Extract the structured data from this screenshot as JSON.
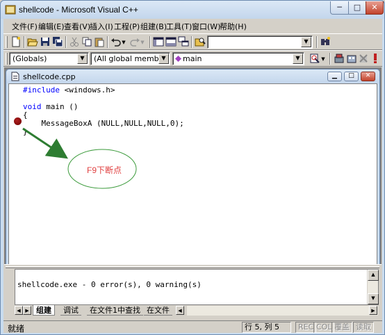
{
  "window": {
    "title": "shellcode - Microsoft Visual C++",
    "min_glyph": "─",
    "max_glyph": "□",
    "close_glyph": "✕"
  },
  "menu": [
    "文件(F)",
    "编辑(E)",
    "查看(V)",
    "插入(I)",
    "工程(P)",
    "组建(B)",
    "工具(T)",
    "窗口(W)",
    "帮助(H)"
  ],
  "toolbar": {
    "find_combo_value": "",
    "dropdown_glyph": "▼"
  },
  "wizardbar": {
    "class_combo": "(Globals)",
    "filter_combo": "(All global members",
    "member_combo": "main",
    "dropdown_glyph": "▼"
  },
  "document": {
    "title": "shellcode.cpp",
    "min_glyph": "▁",
    "max_glyph": "□",
    "close_glyph": "✕",
    "code": {
      "line1_kw": "#include",
      "line1_rest": " <windows.h>",
      "line3_kw": "void",
      "line3_rest": " main ()",
      "line4": "{",
      "line5": "    MessageBoxA (NULL,NULL,NULL,0);",
      "line6": "}"
    },
    "annotation": "F9下断点"
  },
  "output": {
    "text": "shellcode.exe - 0 error(s), 0 warning(s)",
    "up_glyph": "▲",
    "down_glyph": "▼",
    "left_glyph": "◀",
    "right_glyph": "▶",
    "tabs": [
      "组建",
      "调试",
      "在文件1中查找",
      "在文件"
    ],
    "active_tab": 0
  },
  "status": {
    "message": "就绪",
    "position": "行 5, 列 5",
    "indicators": [
      "REC",
      "COL",
      "覆盖",
      "读取"
    ]
  },
  "colors": {
    "keyword": "#0000ff",
    "annotation_text": "#e04040",
    "annotation_ellipse": "#3a9a3a",
    "arrow": "#2e7d32"
  }
}
